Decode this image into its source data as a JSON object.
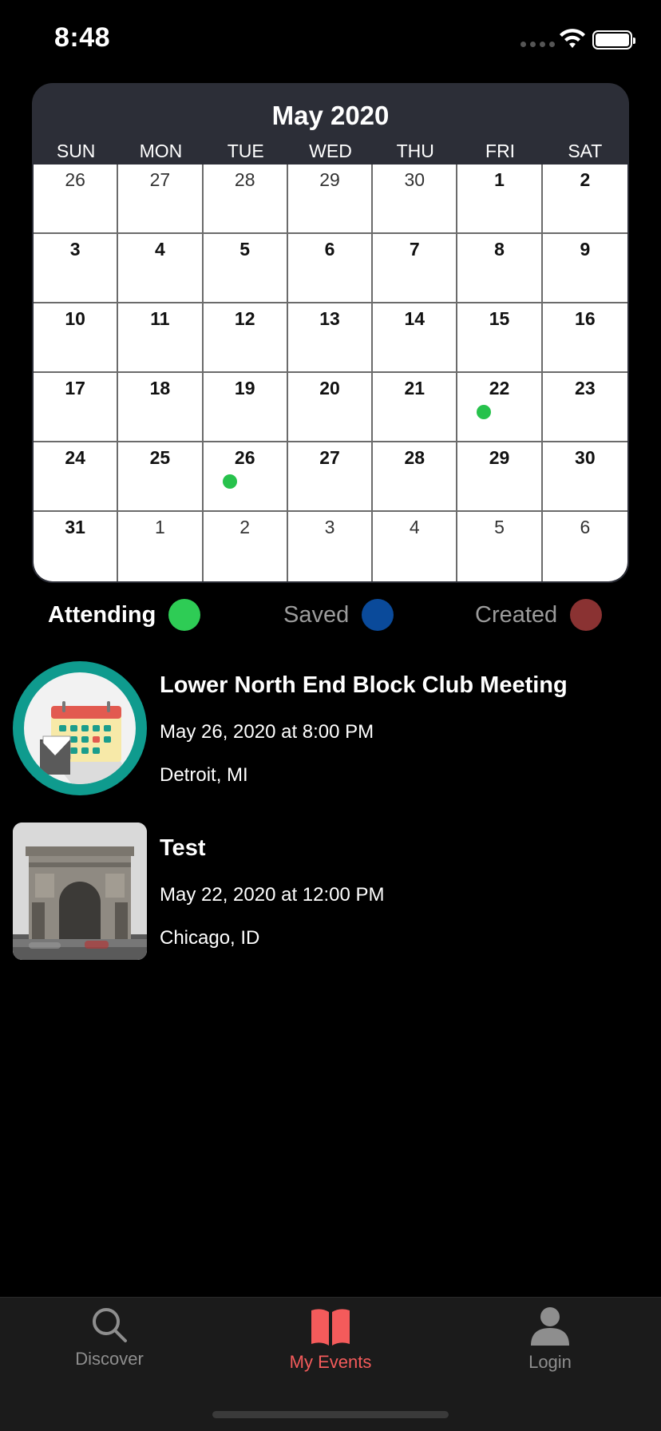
{
  "status": {
    "time": "8:48"
  },
  "calendar": {
    "title": "May 2020",
    "weekdays": [
      "SUN",
      "MON",
      "TUE",
      "WED",
      "THU",
      "FRI",
      "SAT"
    ],
    "days": [
      {
        "d": "26",
        "cur": false
      },
      {
        "d": "27",
        "cur": false
      },
      {
        "d": "28",
        "cur": false
      },
      {
        "d": "29",
        "cur": false
      },
      {
        "d": "30",
        "cur": false
      },
      {
        "d": "1",
        "cur": true
      },
      {
        "d": "2",
        "cur": true
      },
      {
        "d": "3",
        "cur": true
      },
      {
        "d": "4",
        "cur": true
      },
      {
        "d": "5",
        "cur": true
      },
      {
        "d": "6",
        "cur": true
      },
      {
        "d": "7",
        "cur": true
      },
      {
        "d": "8",
        "cur": true
      },
      {
        "d": "9",
        "cur": true
      },
      {
        "d": "10",
        "cur": true
      },
      {
        "d": "11",
        "cur": true
      },
      {
        "d": "12",
        "cur": true
      },
      {
        "d": "13",
        "cur": true
      },
      {
        "d": "14",
        "cur": true
      },
      {
        "d": "15",
        "cur": true
      },
      {
        "d": "16",
        "cur": true
      },
      {
        "d": "17",
        "cur": true
      },
      {
        "d": "18",
        "cur": true
      },
      {
        "d": "19",
        "cur": true
      },
      {
        "d": "20",
        "cur": true
      },
      {
        "d": "21",
        "cur": true
      },
      {
        "d": "22",
        "cur": true,
        "dot": "attending"
      },
      {
        "d": "23",
        "cur": true
      },
      {
        "d": "24",
        "cur": true
      },
      {
        "d": "25",
        "cur": true
      },
      {
        "d": "26",
        "cur": true,
        "dot": "attending"
      },
      {
        "d": "27",
        "cur": true
      },
      {
        "d": "28",
        "cur": true
      },
      {
        "d": "29",
        "cur": true
      },
      {
        "d": "30",
        "cur": true
      },
      {
        "d": "31",
        "cur": true
      },
      {
        "d": "1",
        "cur": false
      },
      {
        "d": "2",
        "cur": false
      },
      {
        "d": "3",
        "cur": false
      },
      {
        "d": "4",
        "cur": false
      },
      {
        "d": "5",
        "cur": false
      },
      {
        "d": "6",
        "cur": false
      }
    ]
  },
  "legend": {
    "attending": {
      "label": "Attending",
      "color": "#2ecc55"
    },
    "saved": {
      "label": "Saved",
      "color": "#0a4a9a"
    },
    "created": {
      "label": "Created",
      "color": "#8a3232"
    }
  },
  "events": [
    {
      "title": "Lower North End Block Club Meeting",
      "date": "May 26, 2020 at 8:00 PM",
      "location": "Detroit, MI",
      "image": "calendar-icon"
    },
    {
      "title": "Test",
      "date": "May 22, 2020 at 12:00 PM",
      "location": "Chicago, ID",
      "image": "arc-de-triomphe-photo"
    }
  ],
  "tabs": {
    "discover": {
      "label": "Discover",
      "icon": "search-icon"
    },
    "my_events": {
      "label": "My Events",
      "icon": "book-icon",
      "active": true
    },
    "login": {
      "label": "Login",
      "icon": "person-icon"
    }
  },
  "colors": {
    "accent": "#f45b5b",
    "attending_dot": "#27c24c",
    "teal": "#0f9b8e"
  }
}
